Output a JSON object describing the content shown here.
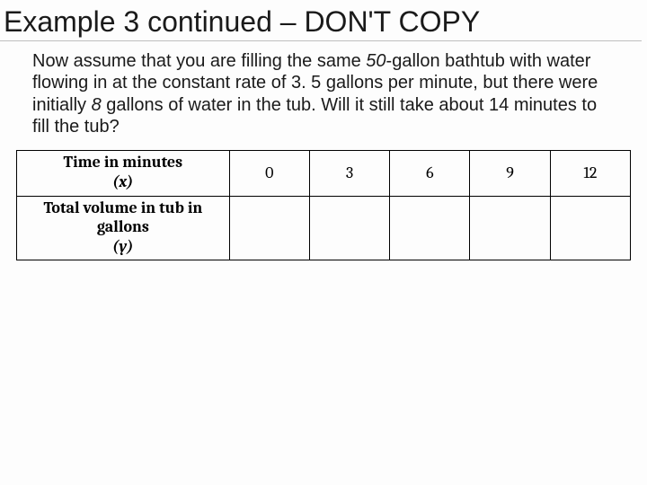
{
  "title_a": "Example 3 continued ",
  "title_b": "– DON'T COPY",
  "body_pre": "Now assume that you are filling the same ",
  "body_it1": "50",
  "body_mid1": "-gallon bathtub with water flowing in at the constant rate of 3. 5 gallons per minute, but there were initially ",
  "body_it2": "8",
  "body_mid2": " gallons of water in the tub. Will it still take about 14 minutes to fill the tub?",
  "table": {
    "row1_label": "Time in minutes",
    "row1_var": "(x)",
    "row2_label": "Total volume in tub in gallons",
    "row2_var": "(y)",
    "cols": [
      "0",
      "3",
      "6",
      "9",
      "12"
    ],
    "row2_vals": [
      "",
      "",
      "",
      "",
      ""
    ]
  },
  "chart_data": {
    "type": "table",
    "columns": [
      "Time in minutes (x)",
      "Total volume in tub in gallons (y)"
    ],
    "rows": [
      {
        "x": 0,
        "y": null
      },
      {
        "x": 3,
        "y": null
      },
      {
        "x": 6,
        "y": null
      },
      {
        "x": 9,
        "y": null
      },
      {
        "x": 12,
        "y": null
      }
    ]
  }
}
